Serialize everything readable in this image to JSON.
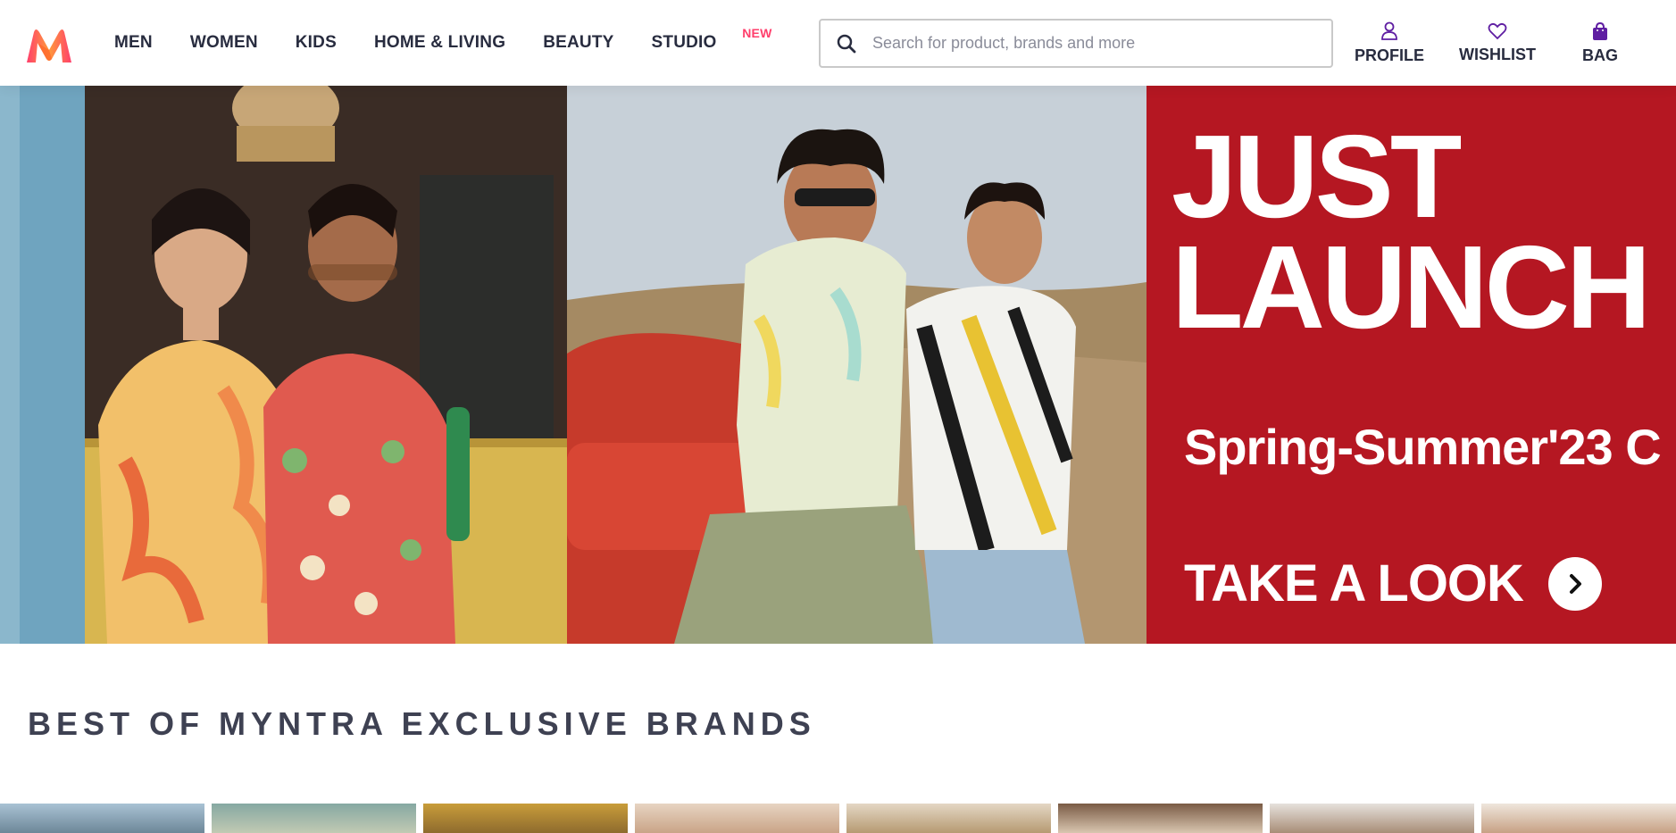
{
  "header": {
    "logo_name": "myntra-logo",
    "nav": [
      {
        "label": "MEN"
      },
      {
        "label": "WOMEN"
      },
      {
        "label": "KIDS"
      },
      {
        "label": "HOME & LIVING"
      },
      {
        "label": "BEAUTY"
      },
      {
        "label": "STUDIO",
        "badge": "NEW"
      }
    ],
    "search": {
      "placeholder": "Search for product, brands and more",
      "value": ""
    },
    "actions": [
      {
        "label": "PROFILE",
        "icon": "user-icon"
      },
      {
        "label": "WISHLIST",
        "icon": "heart-icon"
      },
      {
        "label": "BAG",
        "icon": "bag-icon"
      }
    ]
  },
  "hero": {
    "promo": {
      "title_line1": "JUST",
      "title_line2": "LAUNCH",
      "subtitle": "Spring-Summer'23 C",
      "cta": "TAKE A LOOK"
    }
  },
  "section": {
    "title": "BEST OF MYNTRA EXCLUSIVE BRANDS"
  },
  "colors": {
    "brand_pink": "#ff3f6c",
    "accent_purple": "#5f1ea2",
    "promo_red": "#b51722",
    "text_dark": "#282c3f"
  }
}
